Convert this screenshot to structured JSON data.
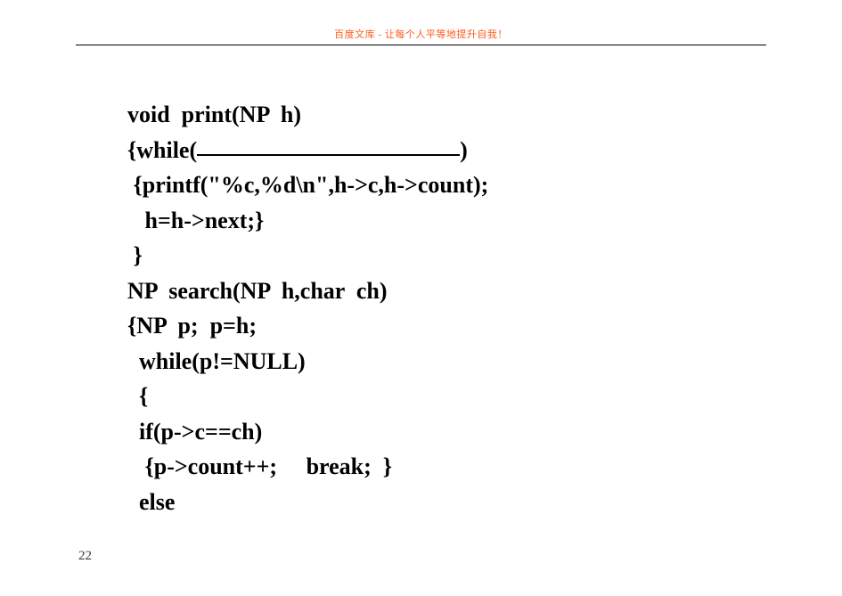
{
  "header": {
    "text": "百度文库 - 让每个人平等地提升自我！"
  },
  "code": {
    "line1_a": "void  print(NP  h)",
    "line2_a": "{while(",
    "line2_b": ")",
    "line3": " {printf(\"%c,%d\\n\",h->c,h->count);",
    "line4": "   h=h->next;}",
    "line5": " }",
    "line6": "NP  search(NP  h,char  ch)",
    "line7": "{NP  p;  p=h;",
    "line8": "  while(p!=NULL)",
    "line9": "  {",
    "line10": "  if(p->c==ch)",
    "line11": "   {p->count++;     break;  }",
    "line12": "  else"
  },
  "page_number": "22"
}
